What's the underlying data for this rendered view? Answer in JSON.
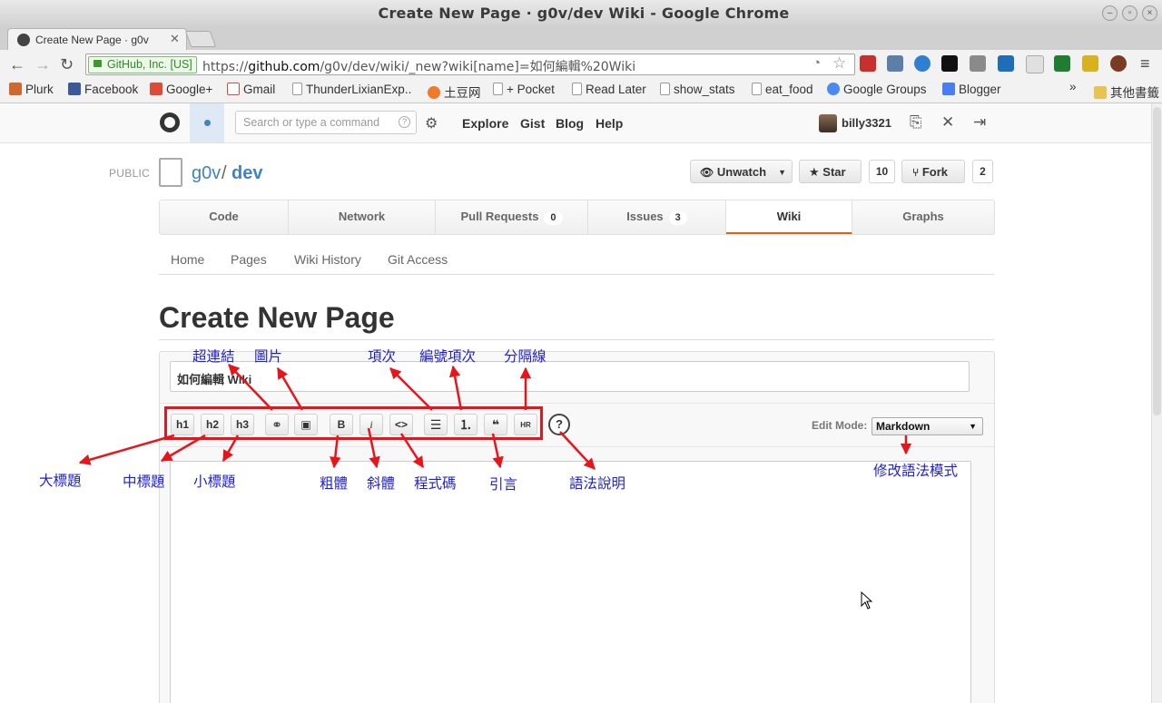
{
  "window": {
    "title": "Create New Page ·  g0v/dev Wiki - Google Chrome",
    "tab_label": "Create New Page · g0v",
    "url_ev": "GitHub, Inc. [US]",
    "url_scheme": "https://",
    "url_host": "github.com",
    "url_path": "/g0v/dev/wiki/_new?wiki[name]=如何編輯%20Wiki"
  },
  "bookmarks": [
    {
      "label": "Plurk",
      "color": "#cf682f"
    },
    {
      "label": "Facebook",
      "color": "#3b5998"
    },
    {
      "label": "Google+",
      "color": "#dd4b39"
    },
    {
      "label": "Gmail",
      "color": "#d54b3d"
    },
    {
      "label": "ThunderLixianExp..",
      "color": "#9a9a9a"
    },
    {
      "label": "土豆网",
      "color": "#f2792b"
    },
    {
      "label": "+ Pocket",
      "color": "#9a9a9a"
    },
    {
      "label": "Read Later",
      "color": "#9a9a9a"
    },
    {
      "label": "show_stats",
      "color": "#9a9a9a"
    },
    {
      "label": "eat_food",
      "color": "#9a9a9a"
    },
    {
      "label": "Google Groups",
      "color": "#4a8af4"
    },
    {
      "label": "Blogger",
      "color": "#4a7cf2"
    }
  ],
  "bookmarks_overflow": "»",
  "bookmarks_other": "其他書籤",
  "header": {
    "search_placeholder": "Search or type a command",
    "nav": [
      "Explore",
      "Gist",
      "Blog",
      "Help"
    ],
    "username": "billy3321"
  },
  "repo": {
    "visibility": "PUBLIC",
    "owner": "g0v",
    "slash": "/",
    "name": "dev",
    "unwatch_label": "Unwatch",
    "star_label": "Star",
    "star_count": "10",
    "fork_label": "Fork",
    "fork_count": "2",
    "tabs": [
      {
        "label": "Code"
      },
      {
        "label": "Network"
      },
      {
        "label": "Pull Requests",
        "count": "0"
      },
      {
        "label": "Issues",
        "count": "3"
      },
      {
        "label": "Wiki"
      },
      {
        "label": "Graphs"
      }
    ]
  },
  "wiki_nav": [
    "Home",
    "Pages",
    "Wiki History",
    "Git Access"
  ],
  "editor": {
    "page_heading": "Create New Page",
    "title_value": "如何編輯 Wiki",
    "toolbar": {
      "h1": "h1",
      "h2": "h2",
      "h3": "h3",
      "bold": "B",
      "italic": "i",
      "code": "<>",
      "quote": "❝",
      "hr": "HR",
      "help": "?"
    },
    "edit_mode_label": "Edit Mode:",
    "edit_mode_value": "Markdown"
  },
  "annotations": {
    "link": "超連結",
    "image": "圖片",
    "ul": "項次",
    "ol": "編號項次",
    "hr": "分隔線",
    "h1": "大標題",
    "h2": "中標題",
    "h3": "小標題",
    "bold": "粗體",
    "italic": "斜體",
    "code": "程式碼",
    "quote": "引言",
    "help": "語法說明",
    "mode": "修改語法模式"
  },
  "colors": {
    "annotation_text": "#1f1fd4",
    "annotation_arrow": "#e8141b",
    "link_blue": "#4183c4",
    "wiki_tab_accent": "#d26911"
  }
}
